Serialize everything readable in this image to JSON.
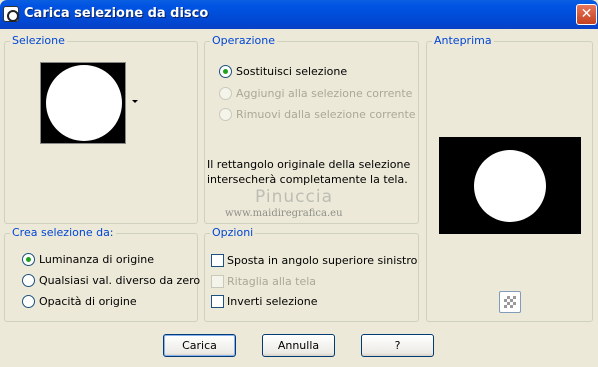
{
  "window": {
    "title": "Carica selezione da disco",
    "close_label": "✕"
  },
  "selezione": {
    "legend": "Selezione"
  },
  "operazione": {
    "legend": "Operazione",
    "options": [
      {
        "label": "Sostituisci selezione",
        "checked": true,
        "enabled": true
      },
      {
        "label": "Aggiungi alla selezione corrente",
        "checked": false,
        "enabled": false
      },
      {
        "label": "Rimuovi dalla selezione corrente",
        "checked": false,
        "enabled": false
      }
    ],
    "description_line1": "Il rettangolo originale della selezione",
    "description_line2": "intersecherà completamente la tela."
  },
  "watermark": {
    "name": "Pinuccia",
    "url": "www.maidiregrafica.eu"
  },
  "anteprima": {
    "legend": "Anteprima"
  },
  "crea": {
    "legend": "Crea selezione da:",
    "options": [
      {
        "label": "Luminanza di origine",
        "checked": true
      },
      {
        "label": "Qualsiasi val. diverso da zero",
        "checked": false
      },
      {
        "label": "Opacità di origine",
        "checked": false
      }
    ]
  },
  "opzioni": {
    "legend": "Opzioni",
    "options": [
      {
        "label": "Sposta in angolo superiore sinistro",
        "checked": false,
        "enabled": true
      },
      {
        "label": "Ritaglia alla tela",
        "checked": false,
        "enabled": false
      },
      {
        "label": "Inverti selezione",
        "checked": false,
        "enabled": true
      }
    ]
  },
  "buttons": {
    "carica": "Carica",
    "annulla": "Annulla",
    "help": "?"
  },
  "colors": {
    "accent": "#0046d5",
    "titlebar": "#0054e3"
  }
}
